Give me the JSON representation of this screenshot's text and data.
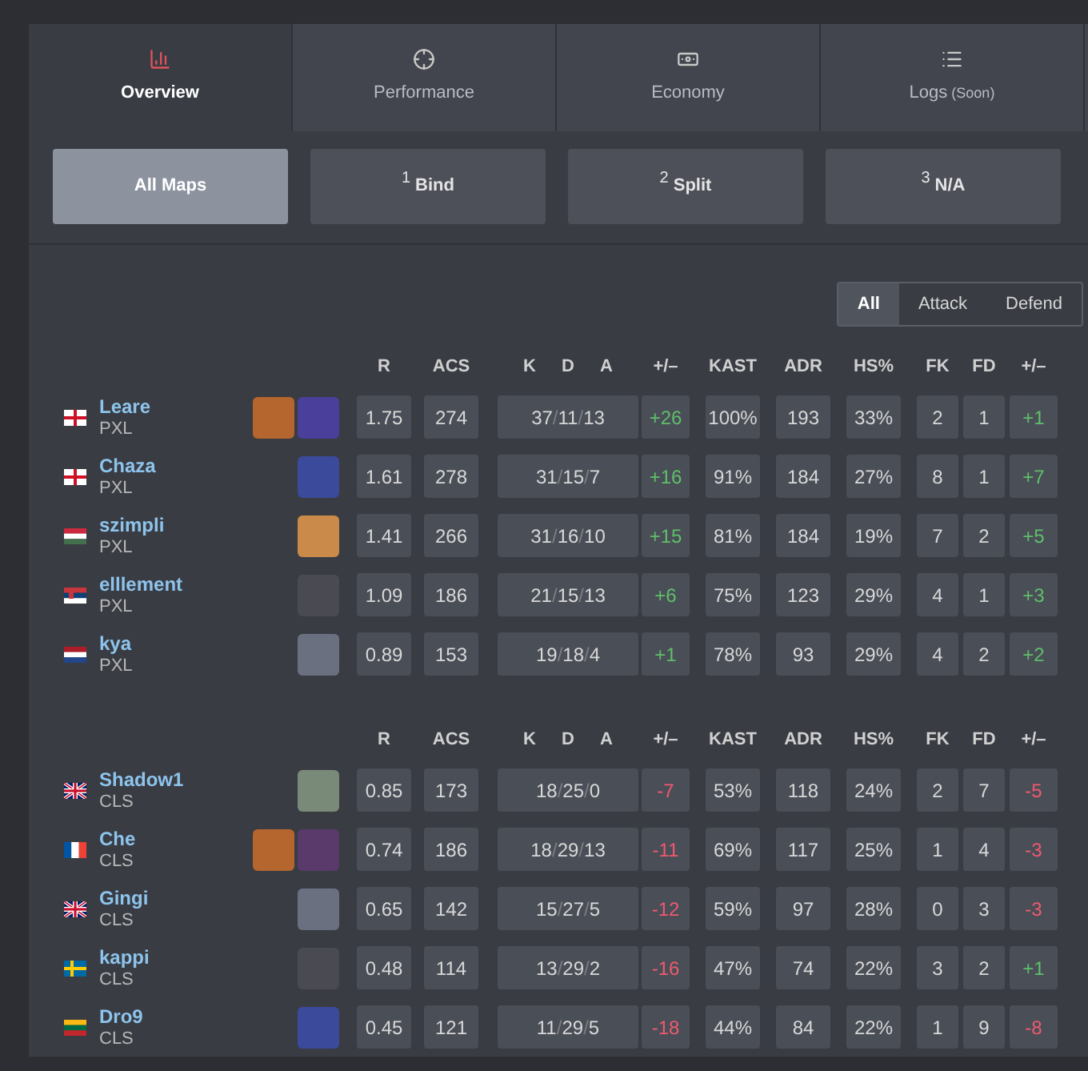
{
  "tabs": [
    {
      "label": "Overview",
      "selected": true
    },
    {
      "label": "Performance",
      "selected": false
    },
    {
      "label": "Economy",
      "selected": false
    },
    {
      "label": "Logs",
      "note": "(Soon)",
      "selected": false
    }
  ],
  "maps": [
    {
      "name": "All Maps",
      "selected": true
    },
    {
      "number": "1",
      "name": "Bind",
      "selected": false
    },
    {
      "number": "2",
      "name": "Split",
      "selected": false
    },
    {
      "number": "3",
      "name": "N/A",
      "selected": false
    }
  ],
  "side_filter": [
    {
      "label": "All",
      "selected": true
    },
    {
      "label": "Attack",
      "selected": false
    },
    {
      "label": "Defend",
      "selected": false
    }
  ],
  "teams": [
    {
      "columns": [
        "R",
        "ACS",
        "K",
        "D",
        "A",
        "+/–",
        "KAST",
        "ADR",
        "HS%",
        "FK",
        "FD",
        "+/–"
      ],
      "players": [
        {
          "name": "Leare",
          "team": "PXL",
          "kind": "england",
          "agents": [
            {
              "color": "#b5652e"
            },
            {
              "color": "#4a3f9a"
            }
          ],
          "r": "1.75",
          "acs": "274",
          "k": "37",
          "sep1": "/",
          "d": "11",
          "sep2": "/",
          "a": "13",
          "diff": "+26",
          "diff_positive": true,
          "kast": "100%",
          "adr": "193",
          "hs": "33%",
          "fk": "2",
          "fd": "1",
          "fk_diff": "+1",
          "fk_positive": true
        },
        {
          "name": "Chaza",
          "team": "PXL",
          "kind": "england",
          "agents": [
            {
              "color": "#3b4a9a"
            }
          ],
          "r": "1.61",
          "acs": "278",
          "k": "31",
          "sep1": "/",
          "d": "15",
          "sep2": "/",
          "a": "7",
          "diff": "+16",
          "diff_positive": true,
          "kast": "91%",
          "adr": "184",
          "hs": "27%",
          "fk": "8",
          "fd": "1",
          "fk_diff": "+7",
          "fk_positive": true
        },
        {
          "name": "szimpli",
          "team": "PXL",
          "kind": "hungary",
          "agents": [
            {
              "color": "#c98a4a"
            }
          ],
          "r": "1.41",
          "acs": "266",
          "k": "31",
          "sep1": "/",
          "d": "16",
          "sep2": "/",
          "a": "10",
          "diff": "+15",
          "diff_positive": true,
          "kast": "81%",
          "adr": "184",
          "hs": "19%",
          "fk": "7",
          "fd": "2",
          "fk_diff": "+5",
          "fk_positive": true
        },
        {
          "name": "elllement",
          "team": "PXL",
          "kind": "serbia",
          "agents": [
            {
              "color": "#4a4a52"
            }
          ],
          "r": "1.09",
          "acs": "186",
          "k": "21",
          "sep1": "/",
          "d": "15",
          "sep2": "/",
          "a": "13",
          "diff": "+6",
          "diff_positive": true,
          "kast": "75%",
          "adr": "123",
          "hs": "29%",
          "fk": "4",
          "fd": "1",
          "fk_diff": "+3",
          "fk_positive": true
        },
        {
          "name": "kya",
          "team": "PXL",
          "kind": "netherlands",
          "agents": [
            {
              "color": "#6a7080"
            }
          ],
          "r": "0.89",
          "acs": "153",
          "k": "19",
          "sep1": "/",
          "d": "18",
          "sep2": "/",
          "a": "4",
          "diff": "+1",
          "diff_positive": true,
          "kast": "78%",
          "adr": "93",
          "hs": "29%",
          "fk": "4",
          "fd": "2",
          "fk_diff": "+2",
          "fk_positive": true
        }
      ]
    },
    {
      "columns": [
        "R",
        "ACS",
        "K",
        "D",
        "A",
        "+/–",
        "KAST",
        "ADR",
        "HS%",
        "FK",
        "FD",
        "+/–"
      ],
      "players": [
        {
          "name": "Shadow1",
          "team": "CLS",
          "kind": "uk",
          "agents": [
            {
              "color": "#7a8a78"
            }
          ],
          "r": "0.85",
          "acs": "173",
          "k": "18",
          "sep1": "/",
          "d": "25",
          "sep2": "/",
          "a": "0",
          "diff": "-7",
          "diff_positive": false,
          "kast": "53%",
          "adr": "118",
          "hs": "24%",
          "fk": "2",
          "fd": "7",
          "fk_diff": "-5",
          "fk_positive": false
        },
        {
          "name": "Che",
          "team": "CLS",
          "kind": "france",
          "agents": [
            {
              "color": "#b5652e"
            },
            {
              "color": "#5a3a6a"
            }
          ],
          "r": "0.74",
          "acs": "186",
          "k": "18",
          "sep1": "/",
          "d": "29",
          "sep2": "/",
          "a": "13",
          "diff": "-11",
          "diff_positive": false,
          "kast": "69%",
          "adr": "117",
          "hs": "25%",
          "fk": "1",
          "fd": "4",
          "fk_diff": "-3",
          "fk_positive": false
        },
        {
          "name": "Gingi",
          "team": "CLS",
          "kind": "uk",
          "agents": [
            {
              "color": "#6a7080"
            }
          ],
          "r": "0.65",
          "acs": "142",
          "k": "15",
          "sep1": "/",
          "d": "27",
          "sep2": "/",
          "a": "5",
          "diff": "-12",
          "diff_positive": false,
          "kast": "59%",
          "adr": "97",
          "hs": "28%",
          "fk": "0",
          "fd": "3",
          "fk_diff": "-3",
          "fk_positive": false
        },
        {
          "name": "kappi",
          "team": "CLS",
          "kind": "sweden",
          "agents": [
            {
              "color": "#4a4a52"
            }
          ],
          "r": "0.48",
          "acs": "114",
          "k": "13",
          "sep1": "/",
          "d": "29",
          "sep2": "/",
          "a": "2",
          "diff": "-16",
          "diff_positive": false,
          "kast": "47%",
          "adr": "74",
          "hs": "22%",
          "fk": "3",
          "fd": "2",
          "fk_diff": "+1",
          "fk_positive": true
        },
        {
          "name": "Dro9",
          "team": "CLS",
          "kind": "lithuania",
          "agents": [
            {
              "color": "#3b4a9a"
            }
          ],
          "r": "0.45",
          "acs": "121",
          "k": "11",
          "sep1": "/",
          "d": "29",
          "sep2": "/",
          "a": "5",
          "diff": "-18",
          "diff_positive": false,
          "kast": "44%",
          "adr": "84",
          "hs": "22%",
          "fk": "1",
          "fd": "9",
          "fk_diff": "-8",
          "fk_positive": false
        }
      ]
    }
  ]
}
